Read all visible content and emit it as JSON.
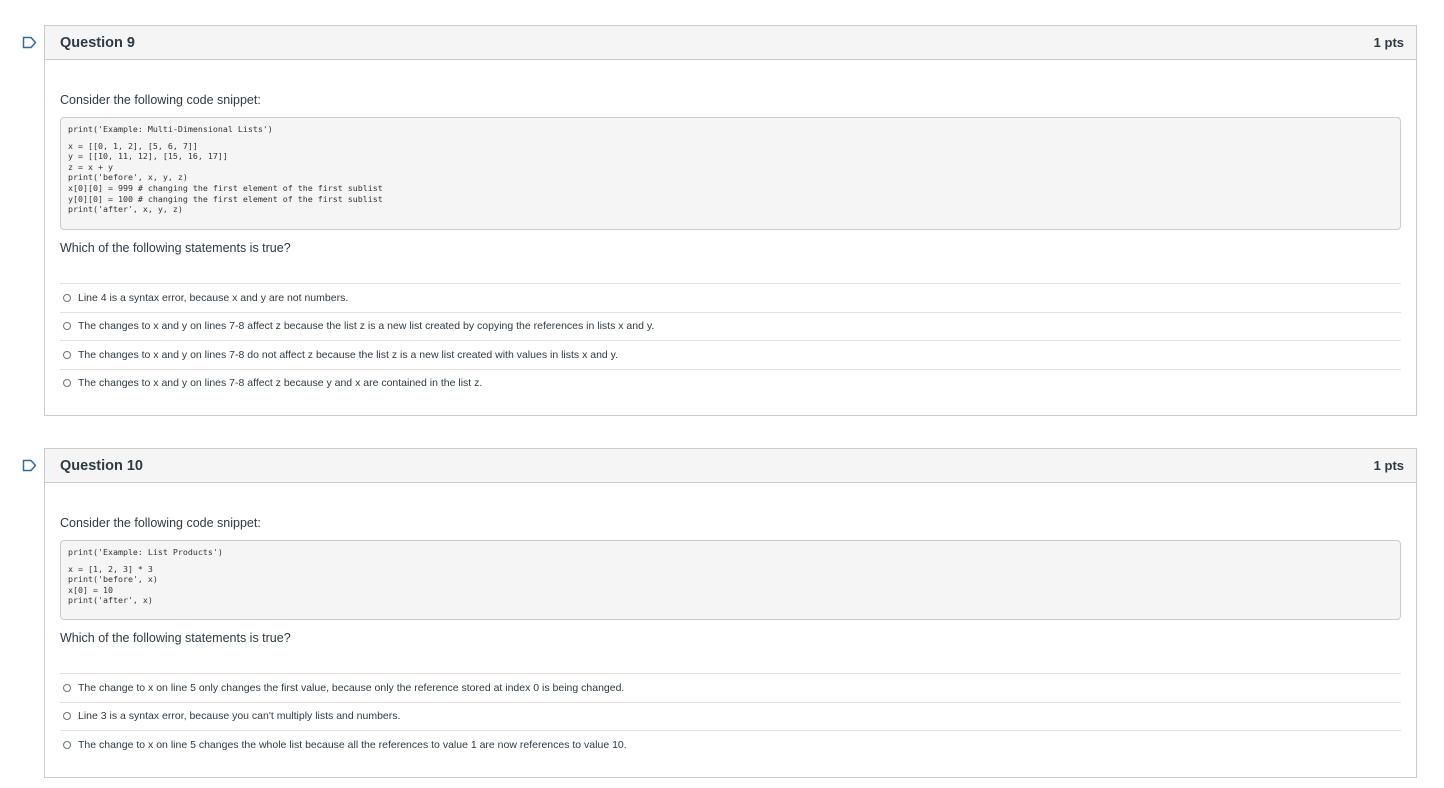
{
  "questions": [
    {
      "title": "Question 9",
      "points": "1 pts",
      "prompt": "Consider the following code snippet:",
      "code_first": "print('Example: Multi-Dimensional Lists')",
      "code_lines": [
        "x = [[0, 1, 2], [5, 6, 7]]",
        "y = [[10, 11, 12], [15, 16, 17]]",
        "z = x + y",
        "print('before', x, y, z)",
        "x[0][0] = 999 # changing the first element of the first sublist",
        "y[0][0] = 100 # changing the first element of the first sublist",
        "print('after', x, y, z)"
      ],
      "question_text": "Which of the following statements is true?",
      "answers": [
        "Line 4 is a syntax error, because x and y are not numbers.",
        "The changes to x and y on lines 7-8 affect z because the list z is a new list created by copying the references in lists x and y.",
        "The changes to x and y on lines 7-8 do not affect z because the list z is a new list created with values in lists x and y.",
        "The changes to x and y on lines 7-8 affect z because y and x are contained in the list z."
      ]
    },
    {
      "title": "Question 10",
      "points": "1 pts",
      "prompt": "Consider the following code snippet:",
      "code_first": "print('Example: List Products')",
      "code_lines": [
        "x = [1, 2, 3] * 3",
        "print('before', x)",
        "x[0] = 10",
        "print('after', x)"
      ],
      "question_text": "Which of the following statements is true?",
      "answers": [
        "The change to x on line 5 only changes the first value, because only the reference stored at index 0 is being changed.",
        "Line 3 is a syntax error, because you can't multiply lists and numbers.",
        "The change to x on line 5 changes the whole list because all the references to value 1 are now references to value 10."
      ]
    }
  ],
  "icons": {
    "flag": "flag-icon",
    "radio": "radio-button"
  },
  "colors": {
    "border": "#c7cdd1",
    "header_bg": "#f5f5f5",
    "text": "#2d3b45",
    "flag": "#2d6ba7"
  }
}
